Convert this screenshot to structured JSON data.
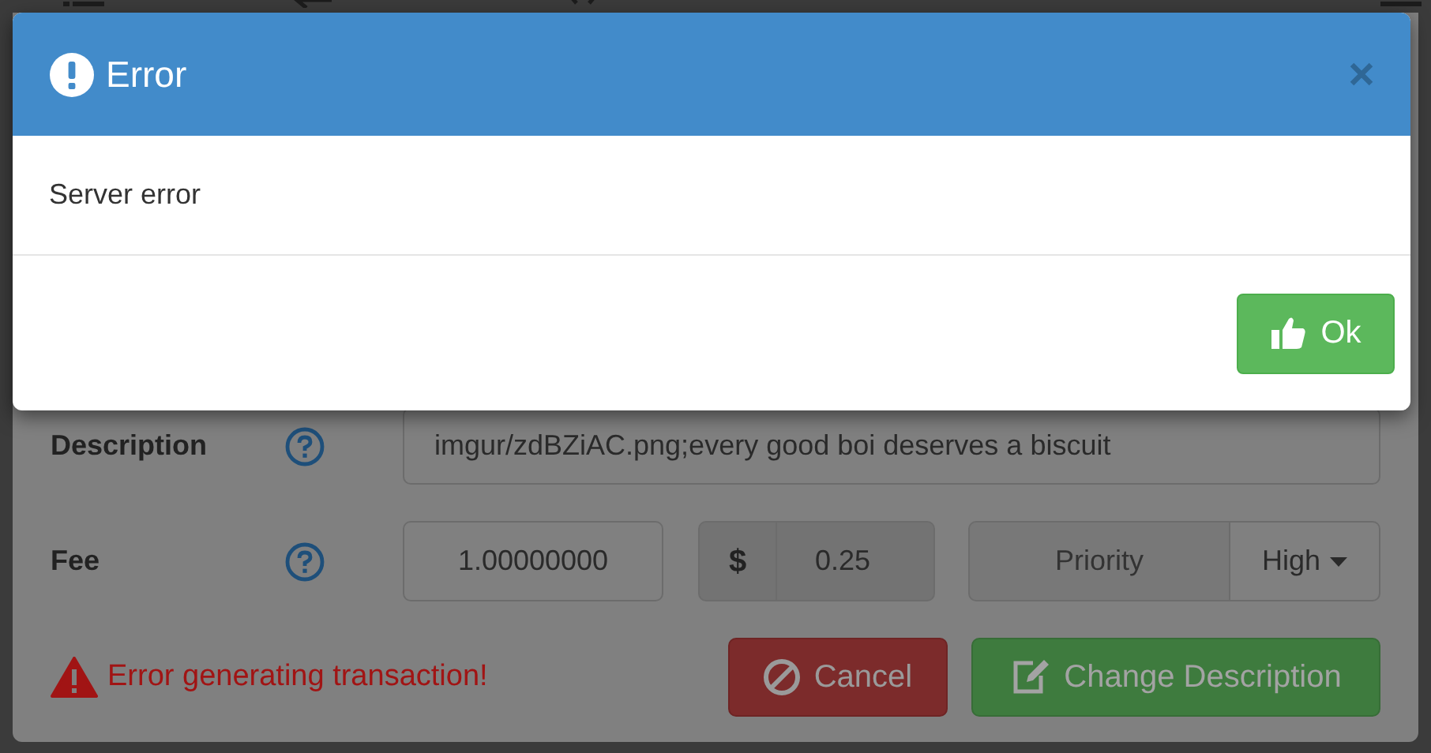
{
  "form": {
    "description": {
      "label": "Description",
      "value": "imgur/zdBZiAC.png;every good boi deserves a biscuit"
    },
    "fee": {
      "label": "Fee",
      "amount": "1.00000000",
      "currency_symbol": "$",
      "fiat": "0.25",
      "priority_label": "Priority",
      "priority": "High"
    },
    "error": "Error generating transaction!",
    "buttons": [
      {
        "label": "Cancel",
        "kind": "cancel"
      },
      {
        "label": "Change Description",
        "kind": "submit"
      }
    ]
  },
  "dialog": {
    "title": "Error",
    "message": "Server error",
    "buttons": [
      "Ok"
    ]
  }
}
